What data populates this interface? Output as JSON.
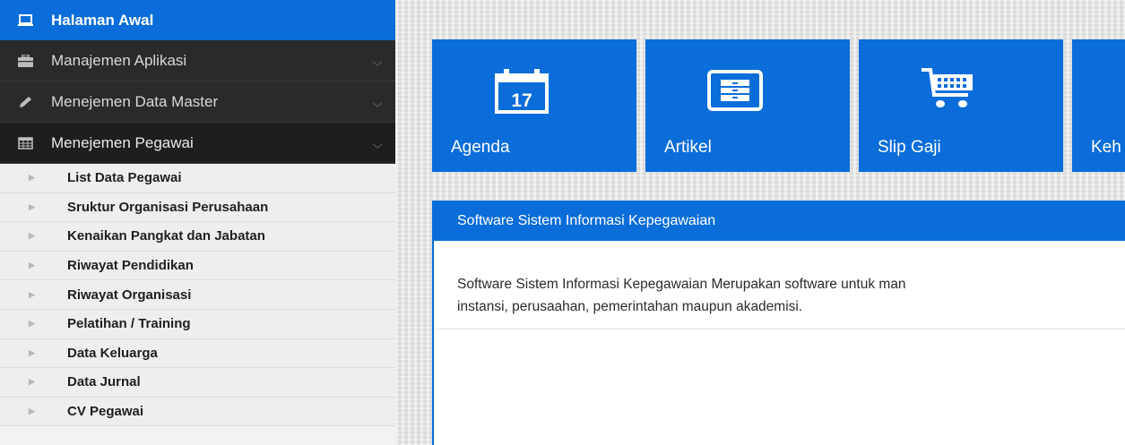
{
  "sidebar": {
    "home": {
      "label": "Halaman Awal",
      "icon": "laptop-icon"
    },
    "menus": [
      {
        "label": "Manajemen Aplikasi",
        "icon": "briefcase-icon"
      },
      {
        "label": "Menejemen Data Master",
        "icon": "pencil-icon"
      },
      {
        "label": "Menejemen Pegawai",
        "icon": "calendar-icon"
      }
    ],
    "sub_items": [
      {
        "label": "List Data Pegawai"
      },
      {
        "label": "Sruktur Organisasi Perusahaan"
      },
      {
        "label": "Kenaikan Pangkat dan Jabatan"
      },
      {
        "label": "Riwayat Pendidikan"
      },
      {
        "label": "Riwayat Organisasi"
      },
      {
        "label": "Pelatihan / Training"
      },
      {
        "label": "Data Keluarga"
      },
      {
        "label": "Data Jurnal"
      },
      {
        "label": "CV Pegawai"
      }
    ]
  },
  "tiles": [
    {
      "label": "Agenda",
      "icon": "calendar-17-icon",
      "icon_text": "17"
    },
    {
      "label": "Artikel",
      "icon": "cabinet-icon"
    },
    {
      "label": "Slip Gaji",
      "icon": "cart-icon"
    },
    {
      "label": "Keh",
      "icon": ""
    }
  ],
  "panel": {
    "title": "Software Sistem Informasi Kepegawaian",
    "body_line1": "Software Sistem Informasi Kepegawaian Merupakan software untuk man",
    "body_line2": "instansi, perusaahan, pemerintahan maupun akademisi."
  },
  "colors": {
    "accent": "#0a6dd9",
    "sidebar_dark": "#2a2a2a",
    "sub_bg": "#eeeeee"
  }
}
